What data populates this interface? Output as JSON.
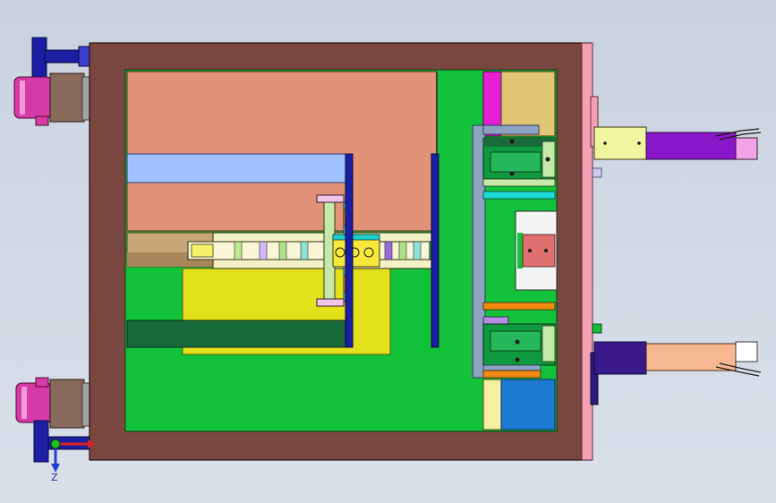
{
  "viewport": {
    "background_color": "#d3dbe6"
  },
  "triad": {
    "axis_label": "Z",
    "x_axis_color": "#e02020",
    "y_axis_color": "#20c020",
    "z_axis_color": "#2040d0"
  },
  "colors": {
    "frame": "#7a4640",
    "cavity_green": "#12c23a",
    "salmon_block": "#e29377",
    "light_blue_bar": "#9fc1ff",
    "yellow_plate": "#e3e01c",
    "dark_green_bar": "#1a6b3c",
    "navy_rail": "#1b1fa3",
    "purple_cylinder": "#8a17c9",
    "peach_cylinder": "#f7b891",
    "pink_cylinder_body": "#d63aa6",
    "slider_blue": "#1c7bd0",
    "tan_block": "#e1c676"
  }
}
